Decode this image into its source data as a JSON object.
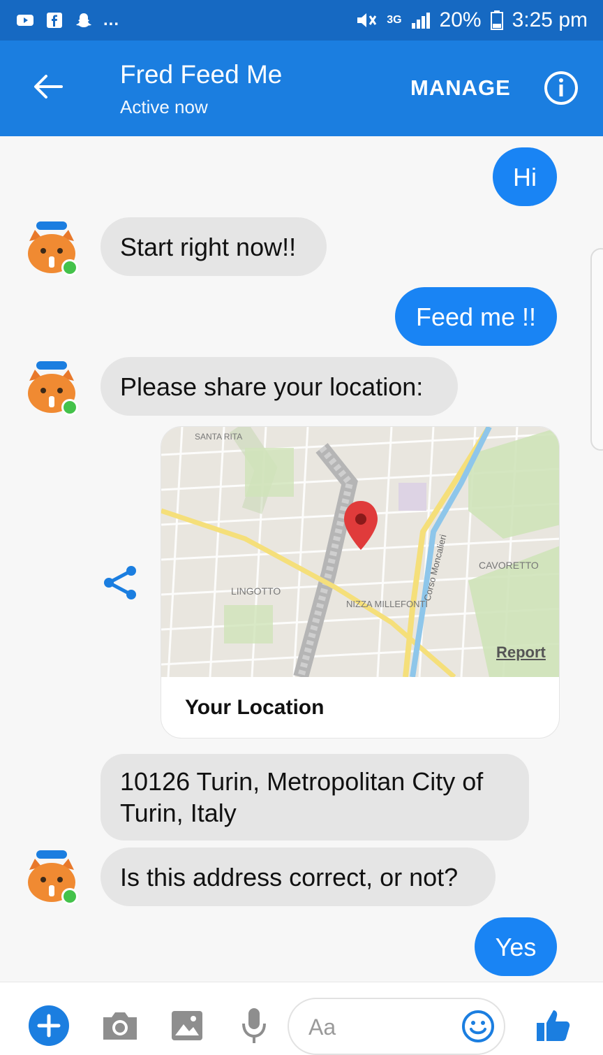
{
  "status_bar": {
    "left_icons": [
      "youtube-icon",
      "facebook-icon",
      "snapchat-icon"
    ],
    "overflow": "...",
    "network": "3G",
    "battery": "20%",
    "time": "3:25 pm"
  },
  "header": {
    "title": "Fred Feed Me",
    "subtitle": "Active now",
    "manage_label": "MANAGE"
  },
  "messages": {
    "m1": "Hi",
    "m2": "Start right now!!",
    "m3": "Feed me !!",
    "m4": "Please share your location:",
    "m5": "10126 Turin, Metropolitan City of Turin, Italy",
    "m6": "Is this address correct, or not?",
    "m7": "Yes"
  },
  "map": {
    "caption": "Your Location",
    "report_label": "Report",
    "labels": {
      "santa_rita": "SANTA RITA",
      "lingotto": "LINGOTTO",
      "nizza": "NIZZA MILLEFONTI",
      "cavoretto": "CAVORETTO",
      "corso": "Corso Moncalieri"
    }
  },
  "composer": {
    "placeholder": "Aa"
  },
  "colors": {
    "accent": "#1b7ee0",
    "status_bar": "#1669c2",
    "outgoing_bubble": "#1984f4",
    "incoming_bubble": "#e5e5e5",
    "online_dot": "#44c24a",
    "map_pin": "#e03b3b"
  }
}
